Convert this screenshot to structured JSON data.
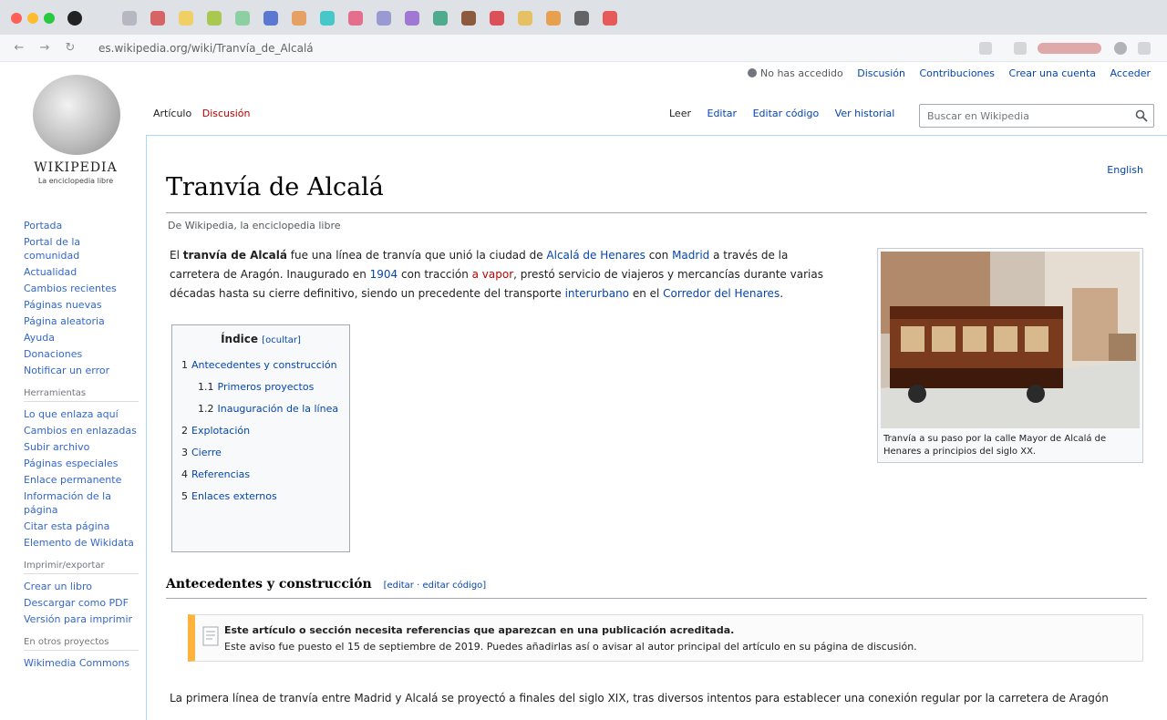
{
  "browser": {
    "url": "es.wikipedia.org/wiki/Tranvía_de_Alcalá",
    "tab_colors": [
      "#b7b7c2",
      "#d76464",
      "#f0d064",
      "#a8c850",
      "#8ccfa2",
      "#5a78d2",
      "#e6a064",
      "#46c8c8",
      "#e46e8c",
      "#9a9ad2",
      "#a078d2",
      "#50aa8c",
      "#8c5a3c",
      "#dc505a",
      "#e6c064",
      "#e6a050",
      "#646464",
      "#e65a5a"
    ]
  },
  "wiki": {
    "logo_text": "WIKIPEDIA",
    "logo_sub": "La enciclopedia libre",
    "personal": {
      "notice": "No has accedido",
      "discussion": "Discusión",
      "contributions": "Contribuciones",
      "create_account": "Crear una cuenta",
      "login": "Acceder"
    },
    "tabs_left": {
      "article": "Artículo",
      "discussion": "Discusión"
    },
    "tabs_right": {
      "read": "Leer",
      "edit": "Editar",
      "edit_source": "Editar código",
      "history": "Ver historial"
    },
    "search_placeholder": "Buscar en Wikipedia",
    "sidebar_groups": [
      {
        "heading": "",
        "links": [
          "Portada",
          "Portal de la comunidad",
          "Actualidad",
          "Cambios recientes",
          "Páginas nuevas",
          "Página aleatoria",
          "Ayuda",
          "Donaciones",
          "Notificar un error"
        ]
      },
      {
        "heading": "Herramientas",
        "links": [
          "Lo que enlaza aquí",
          "Cambios en enlazadas",
          "Subir archivo",
          "Páginas especiales",
          "Enlace permanente",
          "Información de la página",
          "Citar esta página",
          "Elemento de Wikidata"
        ]
      },
      {
        "heading": "Imprimir/exportar",
        "links": [
          "Crear un libro",
          "Descargar como PDF",
          "Versión para imprimir"
        ]
      },
      {
        "heading": "En otros proyectos",
        "links": [
          "Wikimedia Commons"
        ]
      }
    ]
  },
  "article": {
    "language_link": "English",
    "title": "Tranvía de Alcalá",
    "tagline": "De Wikipedia, la enciclopedia libre",
    "lead": [
      {
        "t": "El ",
        "s": ""
      },
      {
        "t": "tranvía de Alcalá",
        "s": "b"
      },
      {
        "t": " fue una línea de tranvía que unió la ciudad de ",
        "s": ""
      },
      {
        "t": "Alcalá de Henares",
        "s": "a"
      },
      {
        "t": " con ",
        "s": ""
      },
      {
        "t": "Madrid",
        "s": "a"
      },
      {
        "t": " a través de la carretera de Aragón. Inaugurado en ",
        "s": ""
      },
      {
        "t": "1904",
        "s": "a"
      },
      {
        "t": " con tracción ",
        "s": ""
      },
      {
        "t": "a vapor",
        "s": "r"
      },
      {
        "t": ", prestó servicio de viajeros y mercancías durante varias décadas hasta su cierre definitivo, siendo un precedente del transporte ",
        "s": ""
      },
      {
        "t": "interurbano",
        "s": "a"
      },
      {
        "t": " en el ",
        "s": ""
      },
      {
        "t": "Corredor del Henares",
        "s": "a"
      },
      {
        "t": ".",
        "s": ""
      }
    ],
    "toc": {
      "title": "Índice",
      "hide": "[ocultar]",
      "items": [
        {
          "n": "1",
          "label": "Antecedentes y construcción",
          "sub": false
        },
        {
          "n": "1.1",
          "label": "Primeros proyectos",
          "sub": true
        },
        {
          "n": "1.2",
          "label": "Inauguración de la línea",
          "sub": true
        },
        {
          "n": "2",
          "label": "Explotación",
          "sub": false
        },
        {
          "n": "3",
          "label": "Cierre",
          "sub": false
        },
        {
          "n": "4",
          "label": "Referencias",
          "sub": false
        },
        {
          "n": "5",
          "label": "Enlaces externos",
          "sub": false
        }
      ]
    },
    "image_caption": "Tranvía a su paso por la calle Mayor de Alcalá de Henares a principios del siglo XX.",
    "section_heading": "Antecedentes y construcción",
    "section_edit": "[editar · editar código]",
    "ambox_bold": "Este artículo o sección necesita referencias que aparezcan en una publicación acreditada.",
    "ambox_text": "Este aviso fue puesto el 15 de septiembre de 2019. Puedes añadirlas así o avisar al autor principal del artículo en su página de discusión.",
    "para2": "La primera línea de tranvía entre Madrid y Alcalá se proyectó a finales del siglo XIX, tras diversos intentos para establecer una conexión regular por la carretera de Aragón"
  }
}
